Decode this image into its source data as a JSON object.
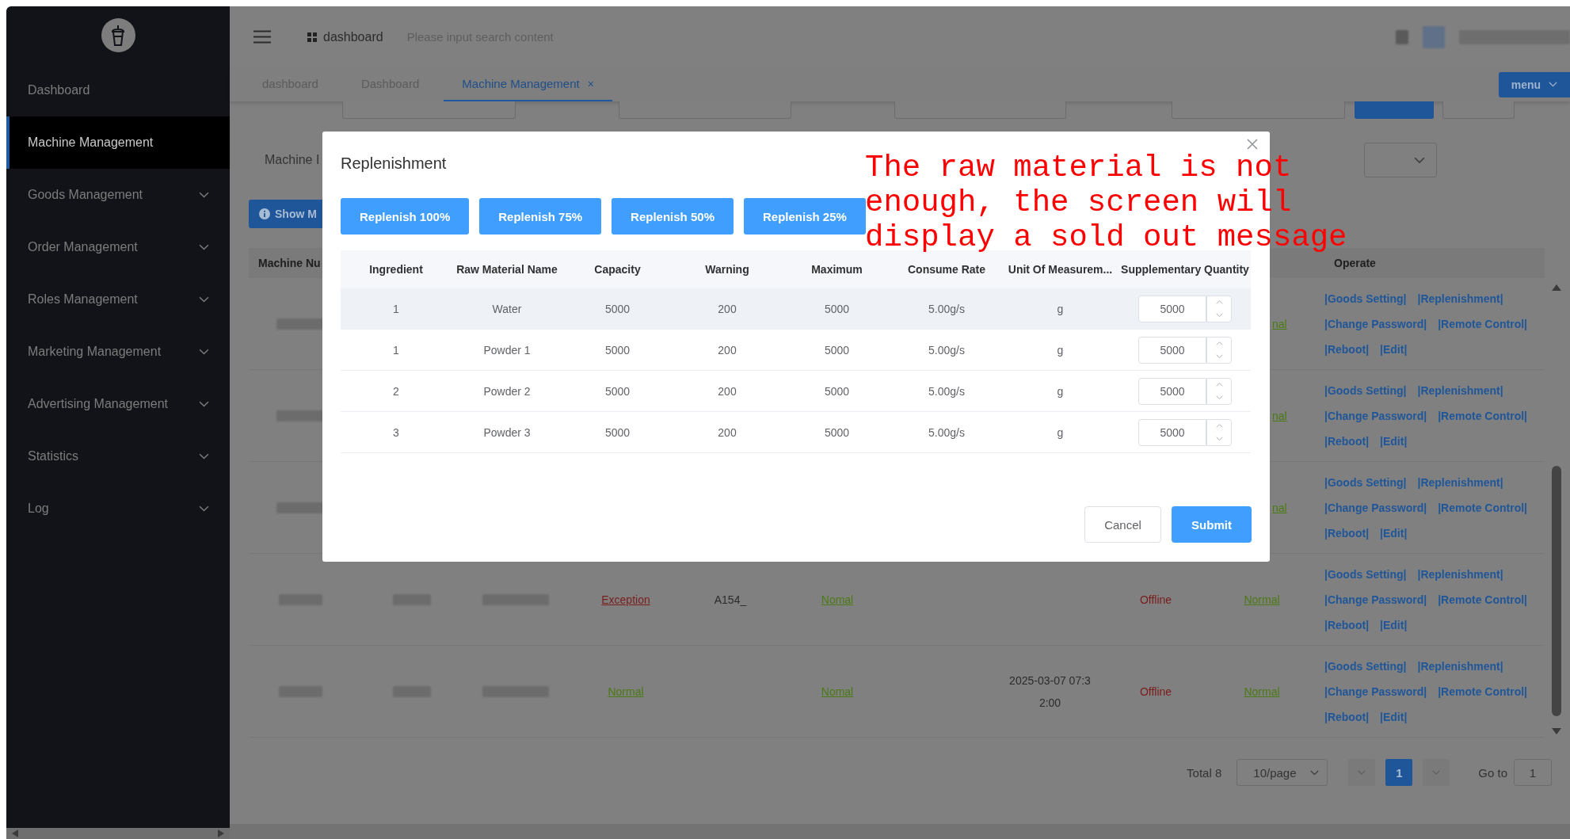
{
  "sidebar": {
    "items": [
      {
        "label": "Dashboard",
        "selected": false,
        "expandable": false
      },
      {
        "label": "Machine Management",
        "selected": true,
        "expandable": false
      },
      {
        "label": "Goods Management",
        "selected": false,
        "expandable": true
      },
      {
        "label": "Order Management",
        "selected": false,
        "expandable": true
      },
      {
        "label": "Roles Management",
        "selected": false,
        "expandable": true
      },
      {
        "label": "Marketing Management",
        "selected": false,
        "expandable": true
      },
      {
        "label": "Advertising Management",
        "selected": false,
        "expandable": true
      },
      {
        "label": "Statistics",
        "selected": false,
        "expandable": true
      },
      {
        "label": "Log",
        "selected": false,
        "expandable": true
      }
    ]
  },
  "header": {
    "breadcrumb": "dashboard",
    "search": {
      "placeholder": "Please input search content"
    }
  },
  "tabs": [
    {
      "label": "dashboard",
      "selected": false,
      "closable": false
    },
    {
      "label": "Dashboard",
      "selected": false,
      "closable": false
    },
    {
      "label": "Machine Management",
      "selected": true,
      "closable": true
    }
  ],
  "tab_close_glyph": "×",
  "menu_button": "menu",
  "filters": {
    "label": "Machine I",
    "show_button": "Show M"
  },
  "table": {
    "header": {
      "column_1": "Machine Nu",
      "operate": "Operate"
    },
    "rows": [
      {
        "kind": "behind_dialog",
        "status_3": "nal",
        "actions": [
          "|Goods Setting|",
          "|Replenishment|",
          "|Change Password|",
          "|Remote Control|",
          "|Reboot|",
          "|Edit|"
        ]
      },
      {
        "kind": "behind_dialog",
        "status_3": "nal",
        "actions": [
          "|Goods Setting|",
          "|Replenishment|",
          "|Change Password|",
          "|Remote Control|",
          "|Reboot|",
          "|Edit|"
        ]
      },
      {
        "kind": "behind_dialog",
        "status_3": "nal",
        "actions": [
          "|Goods Setting|",
          "|Replenishment|",
          "|Change Password|",
          "|Remote Control|",
          "|Reboot|",
          "|Edit|"
        ]
      },
      {
        "kind": "full",
        "status_1": {
          "text": "Exception",
          "color": "#7a1c1c"
        },
        "column_5": "A154_",
        "status_2": {
          "text": "Nomal",
          "color": "#4a7a12"
        },
        "time": "",
        "online": "Offline",
        "status_3": {
          "text": "Normal",
          "color": "#4a7a12"
        },
        "actions": [
          "|Goods Setting|",
          "|Replenishment|",
          "|Change Password|",
          "|Remote Control|",
          "|Reboot|",
          "|Edit|"
        ]
      },
      {
        "kind": "full",
        "status_1": {
          "text": "Normal",
          "color": "#4a7a12"
        },
        "column_5": "",
        "status_2": {
          "text": "Nomal",
          "color": "#4a7a12"
        },
        "time": "2025-03-07 07:32:00",
        "online": "Offline",
        "status_3": {
          "text": "Normal",
          "color": "#4a7a12"
        },
        "actions": [
          "|Goods Setting|",
          "|Replenishment|",
          "|Change Password|",
          "|Remote Control|",
          "|Reboot|",
          "|Edit|"
        ]
      }
    ]
  },
  "pagination": {
    "total": "Total 8",
    "page_size": "10/page",
    "pages": [
      {
        "label": "1",
        "selected": true
      }
    ],
    "goto_label": "Go to",
    "goto_value": "1"
  },
  "dialog": {
    "title": "Replenishment",
    "presets": [
      "Replenish 100%",
      "Replenish 75%",
      "Replenish 50%",
      "Replenish 25%"
    ],
    "columns": [
      "Ingredient",
      "Raw Material Name",
      "Capacity",
      "Warning",
      "Maximum",
      "Consume Rate",
      "Unit Of Measurem...",
      "Supplementary Quantity"
    ],
    "rows": [
      {
        "hovered": true,
        "cells": [
          "1",
          "Water",
          "5000",
          "200",
          "5000",
          "5.00g/s",
          "g"
        ],
        "quantity": "5000"
      },
      {
        "hovered": false,
        "cells": [
          "1",
          "Powder 1",
          "5000",
          "200",
          "5000",
          "5.00g/s",
          "g"
        ],
        "quantity": "5000"
      },
      {
        "hovered": false,
        "cells": [
          "2",
          "Powder 2",
          "5000",
          "200",
          "5000",
          "5.00g/s",
          "g"
        ],
        "quantity": "5000"
      },
      {
        "hovered": false,
        "cells": [
          "3",
          "Powder 3",
          "5000",
          "200",
          "5000",
          "5.00g/s",
          "g"
        ],
        "quantity": "5000"
      }
    ],
    "cancel": "Cancel",
    "submit": "Submit"
  },
  "annotation": "The raw material is not enough, the screen will display a sold out message"
}
